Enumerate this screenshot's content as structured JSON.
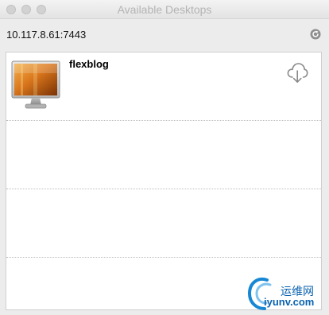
{
  "window": {
    "title": "Available Desktops"
  },
  "server": {
    "address": "10.117.8.61:7443"
  },
  "icons": {
    "refresh": "refresh-icon",
    "monitor": "monitor-icon",
    "download": "cloud-download-icon"
  },
  "desktops": [
    {
      "name": "flexblog"
    }
  ],
  "watermark": {
    "cn_text": "运维网",
    "en_text": "iyunv.com"
  },
  "colors": {
    "title_text": "#b4b4b4",
    "watermark_blue": "#0a62b0"
  }
}
